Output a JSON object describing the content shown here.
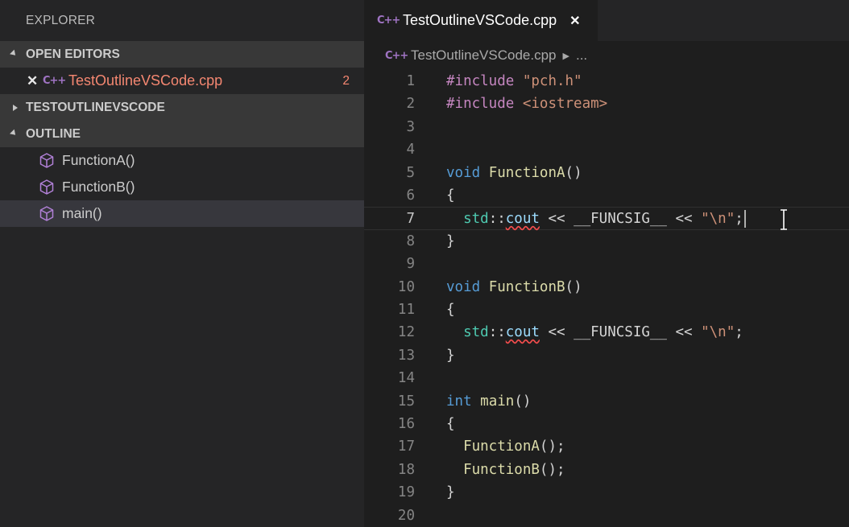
{
  "explorer": {
    "title": "EXPLORER",
    "open_editors": {
      "header": "OPEN EDITORS",
      "items": [
        {
          "close": "✕",
          "icon": "C++",
          "name": "TestOutlineVSCode.cpp",
          "problems": "2"
        }
      ]
    },
    "folder": {
      "header": "TESTOUTLINEVSCODE"
    },
    "outline": {
      "header": "OUTLINE",
      "items": [
        {
          "label": "FunctionA()"
        },
        {
          "label": "FunctionB()"
        },
        {
          "label": "main()"
        }
      ]
    }
  },
  "tab": {
    "icon": "C++",
    "title": "TestOutlineVSCode.cpp",
    "close": "✕"
  },
  "breadcrumb": {
    "icon": "C++",
    "file": "TestOutlineVSCode.cpp",
    "more": "..."
  },
  "editor": {
    "active_line": 7,
    "lines": [
      {
        "n": "1",
        "text": "#include \"pch.h\""
      },
      {
        "n": "2",
        "text": "#include <iostream>"
      },
      {
        "n": "3",
        "text": ""
      },
      {
        "n": "4",
        "text": ""
      },
      {
        "n": "5",
        "text": "void FunctionA()"
      },
      {
        "n": "6",
        "text": "{"
      },
      {
        "n": "7",
        "text": "  std::cout << __FUNCSIG__ << \"\\n\";"
      },
      {
        "n": "8",
        "text": "}"
      },
      {
        "n": "9",
        "text": ""
      },
      {
        "n": "10",
        "text": "void FunctionB()"
      },
      {
        "n": "11",
        "text": "{"
      },
      {
        "n": "12",
        "text": "  std::cout << __FUNCSIG__ << \"\\n\";"
      },
      {
        "n": "13",
        "text": "}"
      },
      {
        "n": "14",
        "text": ""
      },
      {
        "n": "15",
        "text": "int main()"
      },
      {
        "n": "16",
        "text": "{"
      },
      {
        "n": "17",
        "text": "  FunctionA();"
      },
      {
        "n": "18",
        "text": "  FunctionB();"
      },
      {
        "n": "19",
        "text": "}"
      },
      {
        "n": "20",
        "text": ""
      }
    ]
  },
  "colors": {
    "sidebar_bg": "#252526",
    "editor_bg": "#1e1e1e",
    "error_text": "#f48771",
    "keyword": "#569cd6",
    "preprocessor": "#c586c0",
    "string": "#ce9178",
    "function": "#dcdcaa",
    "namespace": "#4ec9b0"
  }
}
